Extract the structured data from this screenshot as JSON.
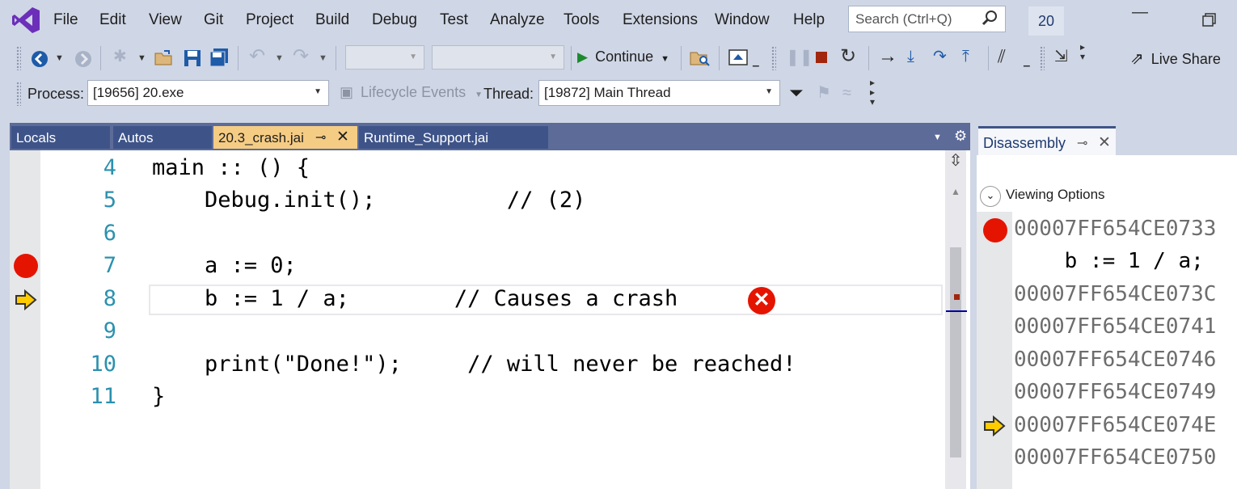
{
  "menubar": {
    "items": [
      "File",
      "Edit",
      "View",
      "Git",
      "Project",
      "Build",
      "Debug",
      "Test",
      "Analyze",
      "Tools",
      "Extensions",
      "Window",
      "Help"
    ],
    "search_placeholder": "Search (Ctrl+Q)",
    "solution_name": "20"
  },
  "toolbar": {
    "continue_label": "Continue",
    "live_share_label": "Live Share",
    "process_label": "Process:",
    "process_value": "[19656] 20.exe",
    "lifecycle_label": "Lifecycle Events",
    "thread_label": "Thread:",
    "thread_value": "[19872] Main Thread"
  },
  "tabs": [
    {
      "label": "Locals",
      "active": false
    },
    {
      "label": "Autos",
      "active": false
    },
    {
      "label": "20.3_crash.jai",
      "active": true
    },
    {
      "label": "Runtime_Support.jai",
      "active": false
    }
  ],
  "editor": {
    "lines": [
      {
        "num": "4",
        "code": "main :: () {"
      },
      {
        "num": "5",
        "code": "    Debug.init();          // (2)"
      },
      {
        "num": "6",
        "code": ""
      },
      {
        "num": "7",
        "code": "    a := 0;"
      },
      {
        "num": "8",
        "code": "    b := 1 / a;        // Causes a crash"
      },
      {
        "num": "9",
        "code": ""
      },
      {
        "num": "10",
        "code": "    print(\"Done!\");     // will never be reached!"
      },
      {
        "num": "11",
        "code": "}"
      }
    ],
    "breakpoint_line": "7",
    "current_line": "8",
    "error_icon": "error-x-icon"
  },
  "disassembly": {
    "title": "Disassembly",
    "viewing_options": "Viewing Options",
    "lines": [
      "00007FF654CE0733",
      "    b := 1 / a;",
      "00007FF654CE073C",
      "00007FF654CE0741",
      "00007FF654CE0746",
      "00007FF654CE0749",
      "00007FF654CE074E",
      "00007FF654CE0750"
    ]
  },
  "colors": {
    "accent": "#68217a",
    "breakpoint": "#e51400",
    "current_arrow": "#ffcc00",
    "active_tab": "#f5cc84",
    "line_number": "#2b91af"
  }
}
